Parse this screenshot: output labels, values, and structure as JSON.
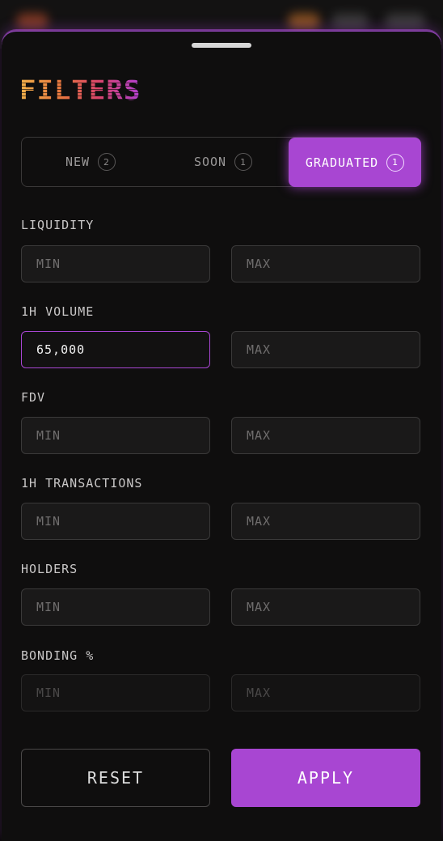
{
  "sheet": {
    "title": "FILTERS"
  },
  "tabs": [
    {
      "label": "NEW",
      "count": "2",
      "active": false
    },
    {
      "label": "SOON",
      "count": "1",
      "active": false
    },
    {
      "label": "GRADUATED",
      "count": "1",
      "active": true
    }
  ],
  "filters": [
    {
      "label": "LIQUIDITY",
      "min": {
        "placeholder": "MIN",
        "value": ""
      },
      "max": {
        "placeholder": "MAX",
        "value": ""
      }
    },
    {
      "label": "1H VOLUME",
      "min": {
        "placeholder": "MIN",
        "value": "65,000"
      },
      "max": {
        "placeholder": "MAX",
        "value": ""
      }
    },
    {
      "label": "FDV",
      "min": {
        "placeholder": "MIN",
        "value": ""
      },
      "max": {
        "placeholder": "MAX",
        "value": ""
      }
    },
    {
      "label": "1H TRANSACTIONS",
      "min": {
        "placeholder": "MIN",
        "value": ""
      },
      "max": {
        "placeholder": "MAX",
        "value": ""
      }
    },
    {
      "label": "HOLDERS",
      "min": {
        "placeholder": "MIN",
        "value": ""
      },
      "max": {
        "placeholder": "MAX",
        "value": ""
      }
    },
    {
      "label": "BONDING %",
      "min": {
        "placeholder": "MIN",
        "value": ""
      },
      "max": {
        "placeholder": "MAX",
        "value": ""
      }
    }
  ],
  "actions": {
    "reset_label": "RESET",
    "apply_label": "APPLY"
  },
  "colors": {
    "accent": "#a846d2",
    "background": "#0f0e0e",
    "field_background": "#1a1919",
    "title_gradient": [
      "#f2b14a",
      "#e8763f",
      "#d9456a",
      "#b13fd0"
    ]
  }
}
